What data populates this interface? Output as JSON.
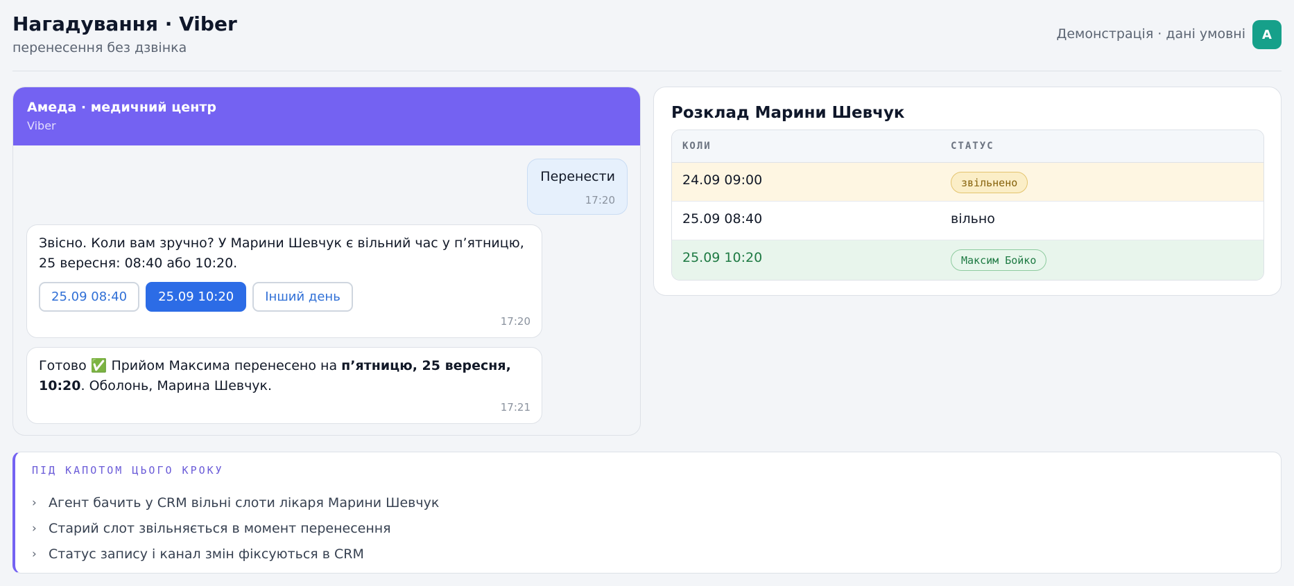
{
  "header": {
    "title": "Нагадування · Viber",
    "subtitle": "перенесення без дзвінка",
    "demo_note": "Демонстрація · дані умовні",
    "avatar_initial": "A"
  },
  "chat": {
    "title": "Амеда · медичний центр",
    "channel": "Viber",
    "messages": [
      {
        "direction": "out",
        "text": "Перенести",
        "time": "17:20"
      },
      {
        "direction": "in",
        "text": "Звісно. Коли вам зручно? У Марини Шевчук є вільний час у п’ятницю, 25 вересня: 08:40 або 10:20.",
        "time": "17:20",
        "quick_replies": [
          {
            "label": "25.09 08:40",
            "selected": false
          },
          {
            "label": "25.09 10:20",
            "selected": true
          },
          {
            "label": "Інший день",
            "selected": false
          }
        ]
      },
      {
        "direction": "in",
        "text_before": "Готово ✅ Прийом Максима перенесено на ",
        "text_bold": "п’ятницю, 25 вересня, 10:20",
        "text_after": ". Оболонь, Марина Шевчук.",
        "time": "17:21"
      }
    ]
  },
  "schedule": {
    "title": "Розклад Марини Шевчук",
    "columns": [
      "КОЛИ",
      "СТАТУС"
    ],
    "rows": [
      {
        "when": "24.09 09:00",
        "status": "звільнено",
        "status_type": "badge-freed"
      },
      {
        "when": "25.09 08:40",
        "status": "вільно",
        "status_type": "plain"
      },
      {
        "when": "25.09 10:20",
        "status": "Максим Бойко",
        "status_type": "badge-booked"
      }
    ]
  },
  "under_the_hood": {
    "title": "ПІД КАПОТОМ ЦЬОГО КРОКУ",
    "items": [
      "Агент бачить у CRM вільні слоти лікаря Марини Шевчук",
      "Старий слот звільняється в момент перенесення",
      "Статус запису і канал змін фіксуються в CRM"
    ]
  },
  "colors": {
    "accent": "#7462f2",
    "selected_reply": "#2c6ce6",
    "avatar": "#16a08a",
    "freed_row": "#fef6e2",
    "booked_row": "#e8f5ec"
  }
}
